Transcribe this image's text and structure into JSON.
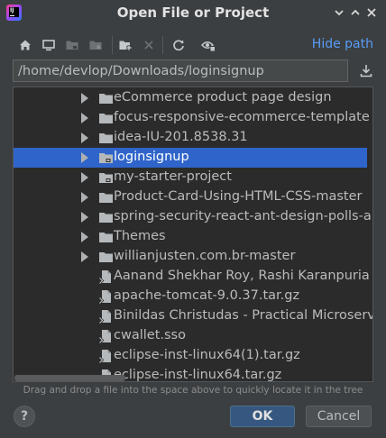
{
  "window": {
    "title": "Open File or Project",
    "controls": [
      "chevron-down-icon",
      "chevron-up-icon",
      "close-icon"
    ]
  },
  "toolbar": {
    "icons": [
      "home-icon",
      "desktop-icon",
      "project-folder-icon",
      "module-folder-icon",
      "new-folder-icon",
      "delete-icon",
      "refresh-icon",
      "show-hidden-icon"
    ],
    "hide_path_label": "Hide path"
  },
  "path": {
    "value": "/home/devlop/Downloads/loginsignup"
  },
  "tree": {
    "selected_index": 3,
    "items": [
      {
        "label": "eCommerce product page design",
        "type": "folder",
        "expandable": true
      },
      {
        "label": "focus-responsive-ecommerce-template",
        "type": "folder",
        "expandable": true
      },
      {
        "label": "idea-IU-201.8538.31",
        "type": "folder",
        "expandable": true
      },
      {
        "label": "loginsignup",
        "type": "project-folder",
        "expandable": true
      },
      {
        "label": "my-starter-project",
        "type": "project-folder",
        "expandable": true
      },
      {
        "label": "Product-Card-Using-HTML-CSS-master",
        "type": "folder",
        "expandable": true
      },
      {
        "label": "spring-security-react-ant-design-polls-app-",
        "type": "folder",
        "expandable": true
      },
      {
        "label": "Themes",
        "type": "folder",
        "expandable": true
      },
      {
        "label": "willianjusten.com.br-master",
        "type": "folder",
        "expandable": true
      },
      {
        "label": "Aanand Shekhar Roy, Rashi Karanpuria - Ko",
        "type": "file",
        "expandable": false
      },
      {
        "label": "apache-tomcat-9.0.37.tar.gz",
        "type": "file",
        "expandable": false
      },
      {
        "label": "Binildas Christudas - Practical Microservice",
        "type": "file",
        "expandable": false
      },
      {
        "label": "cwallet.sso",
        "type": "file",
        "expandable": false
      },
      {
        "label": "eclipse-inst-linux64(1).tar.gz",
        "type": "file",
        "expandable": false
      },
      {
        "label": "eclipse-inst-linux64.tar.gz",
        "type": "file",
        "expandable": false
      }
    ]
  },
  "hint": "Drag and drop a file into the space above to quickly locate it in the tree",
  "buttons": {
    "help": "?",
    "ok": "OK",
    "cancel": "Cancel"
  },
  "colors": {
    "background": "#3c3f41",
    "tree_background": "#2b2b2b",
    "selection": "#2f65ca",
    "link": "#589df6",
    "ok_button": "#365880"
  }
}
